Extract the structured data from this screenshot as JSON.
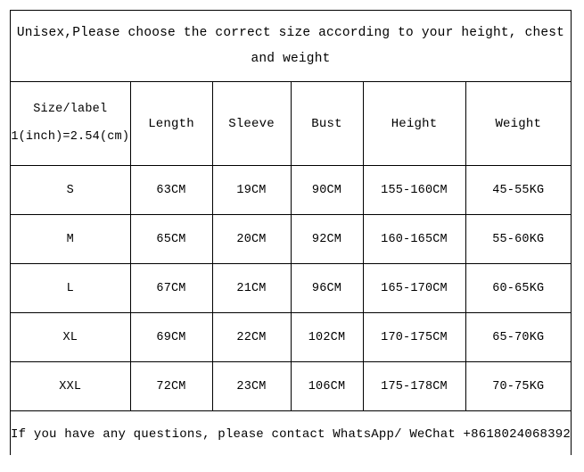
{
  "banner": {
    "text": "Unisex,Please choose the correct size according to your height, chest and weight"
  },
  "table": {
    "size_label_header": {
      "main": "Size/label",
      "sub": "1(inch)=2.54(cm)"
    },
    "columns": [
      "Length",
      "Sleeve",
      "Bust",
      "Height",
      "Weight"
    ],
    "rows": [
      {
        "size": "S",
        "length": "63CM",
        "sleeve": "19CM",
        "bust": "90CM",
        "height": "155-160CM",
        "weight": "45-55KG"
      },
      {
        "size": "M",
        "length": "65CM",
        "sleeve": "20CM",
        "bust": "92CM",
        "height": "160-165CM",
        "weight": "55-60KG"
      },
      {
        "size": "L",
        "length": "67CM",
        "sleeve": "21CM",
        "bust": "96CM",
        "height": "165-170CM",
        "weight": "60-65KG"
      },
      {
        "size": "XL",
        "length": "69CM",
        "sleeve": "22CM",
        "bust": "102CM",
        "height": "170-175CM",
        "weight": "65-70KG"
      },
      {
        "size": "XXL",
        "length": "72CM",
        "sleeve": "23CM",
        "bust": "106CM",
        "height": "175-178CM",
        "weight": "70-75KG"
      }
    ]
  },
  "footer": {
    "text": "If you have any questions, please contact WhatsApp/ WeChat +8618024068392"
  },
  "colors": {
    "border": "#000000",
    "background": "#ffffff",
    "text": "#000000"
  }
}
